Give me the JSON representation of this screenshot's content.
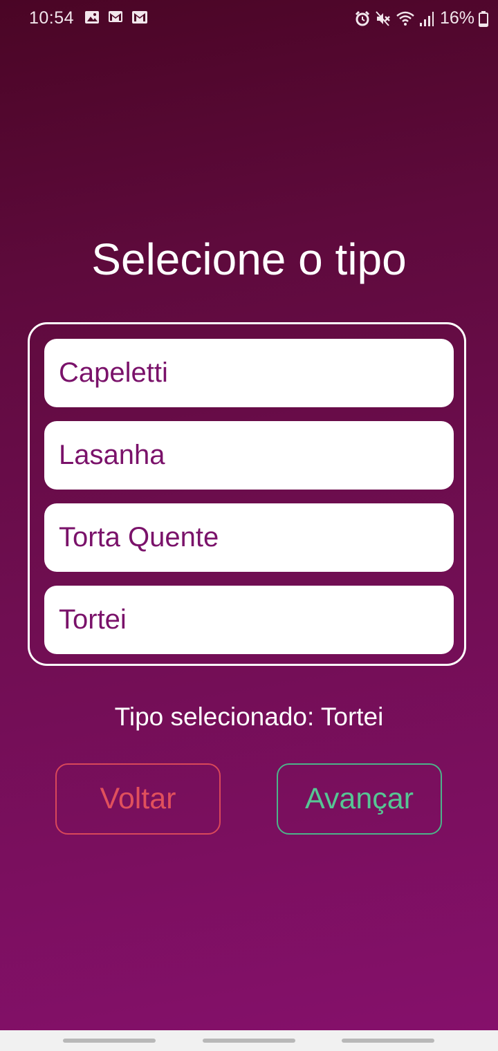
{
  "status_bar": {
    "time": "10:54",
    "battery": "16%",
    "icons": [
      "image-icon",
      "gmail-icon",
      "gmail-icon",
      "alarm-icon",
      "mute-icon",
      "wifi-icon",
      "signal-icon",
      "battery-icon"
    ]
  },
  "title": "Selecione o tipo",
  "options": [
    {
      "label": "Capeletti"
    },
    {
      "label": "Lasanha"
    },
    {
      "label": "Torta Quente"
    },
    {
      "label": "Tortei"
    }
  ],
  "selected_text": "Tipo selecionado: Tortei",
  "buttons": {
    "back_label": "Voltar",
    "next_label": "Avançar"
  },
  "colors": {
    "accent": "#7a126a",
    "back": "#e0505c",
    "next": "#56c694"
  }
}
